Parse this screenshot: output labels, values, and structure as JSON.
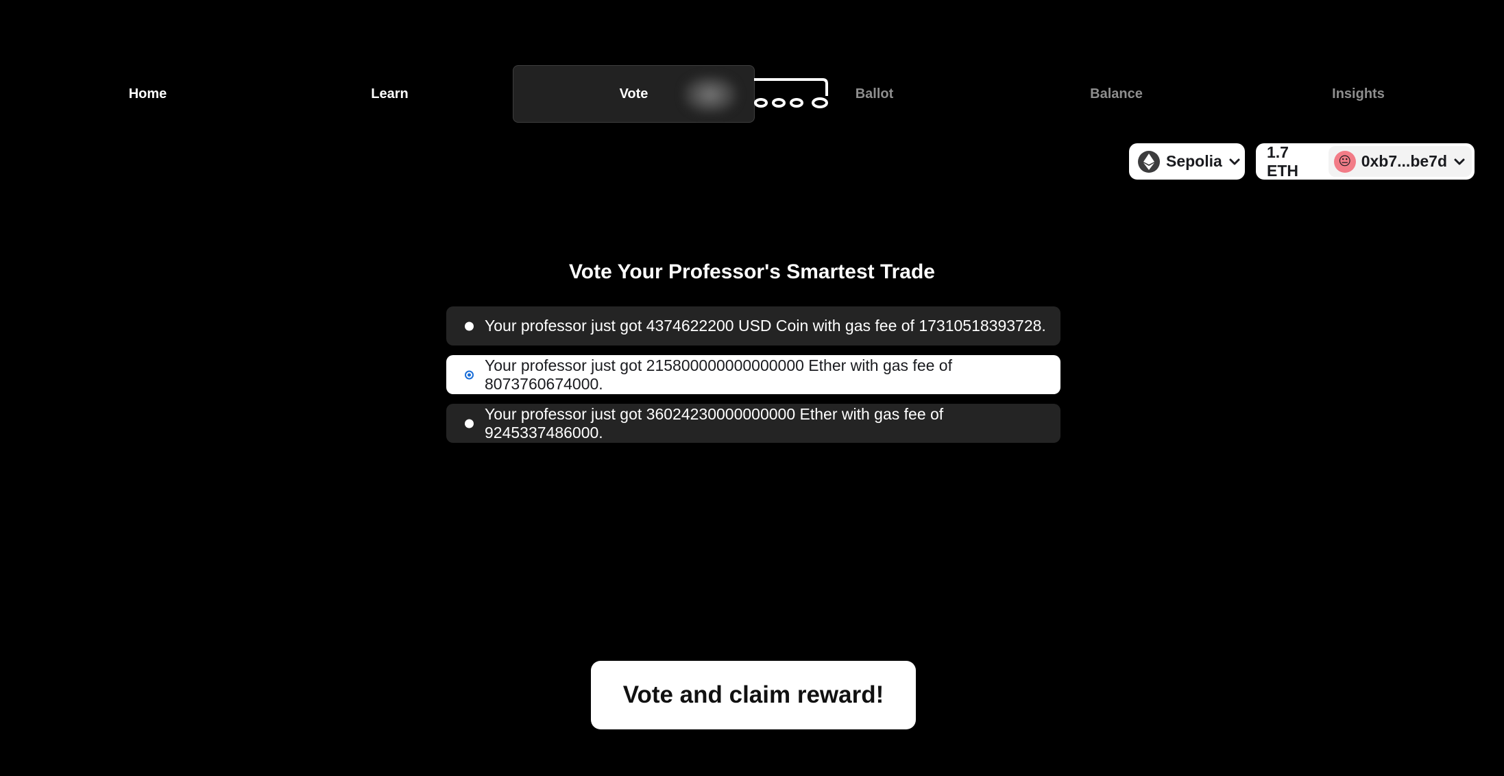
{
  "nav": {
    "items": [
      {
        "label": "Home"
      },
      {
        "label": "Learn"
      },
      {
        "label": "Vote"
      },
      {
        "label": "Ballot"
      },
      {
        "label": "Balance"
      },
      {
        "label": "Insights"
      }
    ],
    "current": "Vote"
  },
  "wallet": {
    "network": "Sepolia",
    "network_icon": "ethereum-icon",
    "balance": "1.7 ETH",
    "account": "0xb7...be7d",
    "avatar_emoji": "😐",
    "avatar_color": "#f27c87"
  },
  "main": {
    "title": "Vote Your Professor's Smartest Trade",
    "options": [
      {
        "label": "Your professor just got 4374622200 USD Coin with gas fee of 17310518393728.",
        "selected": false
      },
      {
        "label": "Your professor just got 215800000000000000 Ether with gas fee of 8073760674000.",
        "selected": true
      },
      {
        "label": "Your professor just got 36024230000000000 Ether with gas fee of 9245337486000.",
        "selected": false
      }
    ],
    "submit_label": "Vote and claim reward!"
  },
  "colors": {
    "background": "#000000",
    "option_bg": "#242424",
    "selected_bg": "#ffffff",
    "radio_accent": "#1a6ed8",
    "nav_dim": "#8e8e8e"
  }
}
